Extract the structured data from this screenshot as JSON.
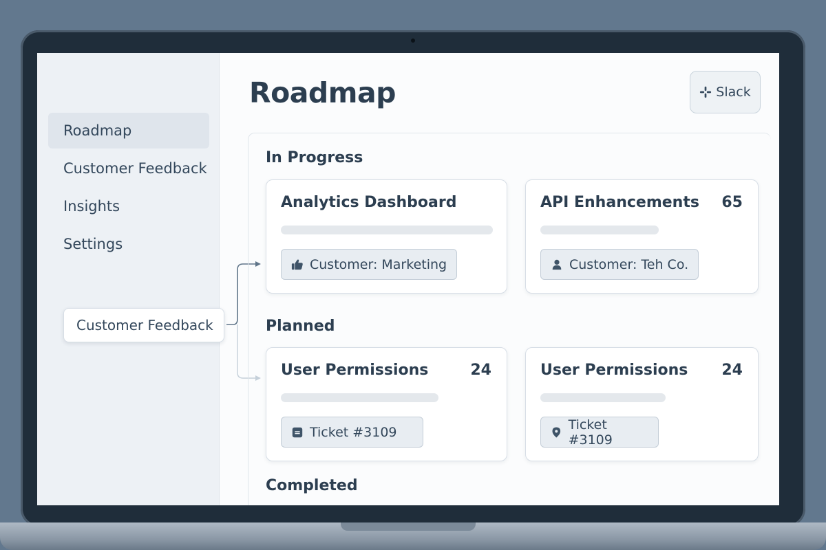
{
  "sidebar": {
    "items": [
      {
        "label": "Roadmap",
        "active": true
      },
      {
        "label": "Customer Feedback"
      },
      {
        "label": "Insights"
      },
      {
        "label": "Settings"
      }
    ],
    "floating_chip": "Customer Feedback"
  },
  "header": {
    "title": "Roadmap",
    "slack_label": "Slack"
  },
  "sections": {
    "in_progress": {
      "title": "In Progress",
      "cards": [
        {
          "title": "Analytics Dashboard",
          "count": "",
          "tag": "Customer: Marketing",
          "tag_icon": "thumbs-up-icon"
        },
        {
          "title": "API Enhancements",
          "count": "65",
          "tag": "Customer: Teh Co.",
          "tag_icon": "user-icon"
        }
      ]
    },
    "planned": {
      "title": "Planned",
      "cards": [
        {
          "title": "User Permissions",
          "count": "24",
          "tag": "Ticket #3109",
          "tag_icon": "ticket-icon"
        },
        {
          "title": "User Permissions",
          "count": "24",
          "tag": "Ticket #3109",
          "tag_icon": "location-pin-icon"
        }
      ]
    },
    "completed": {
      "title": "Completed"
    }
  },
  "colors": {
    "background": "#62788e",
    "screen": "#fbfcfd",
    "sidebar": "#edf1f5",
    "active_nav": "#dfe5ec",
    "text": "#2c3e50",
    "tag_bg": "#e8edf2"
  }
}
